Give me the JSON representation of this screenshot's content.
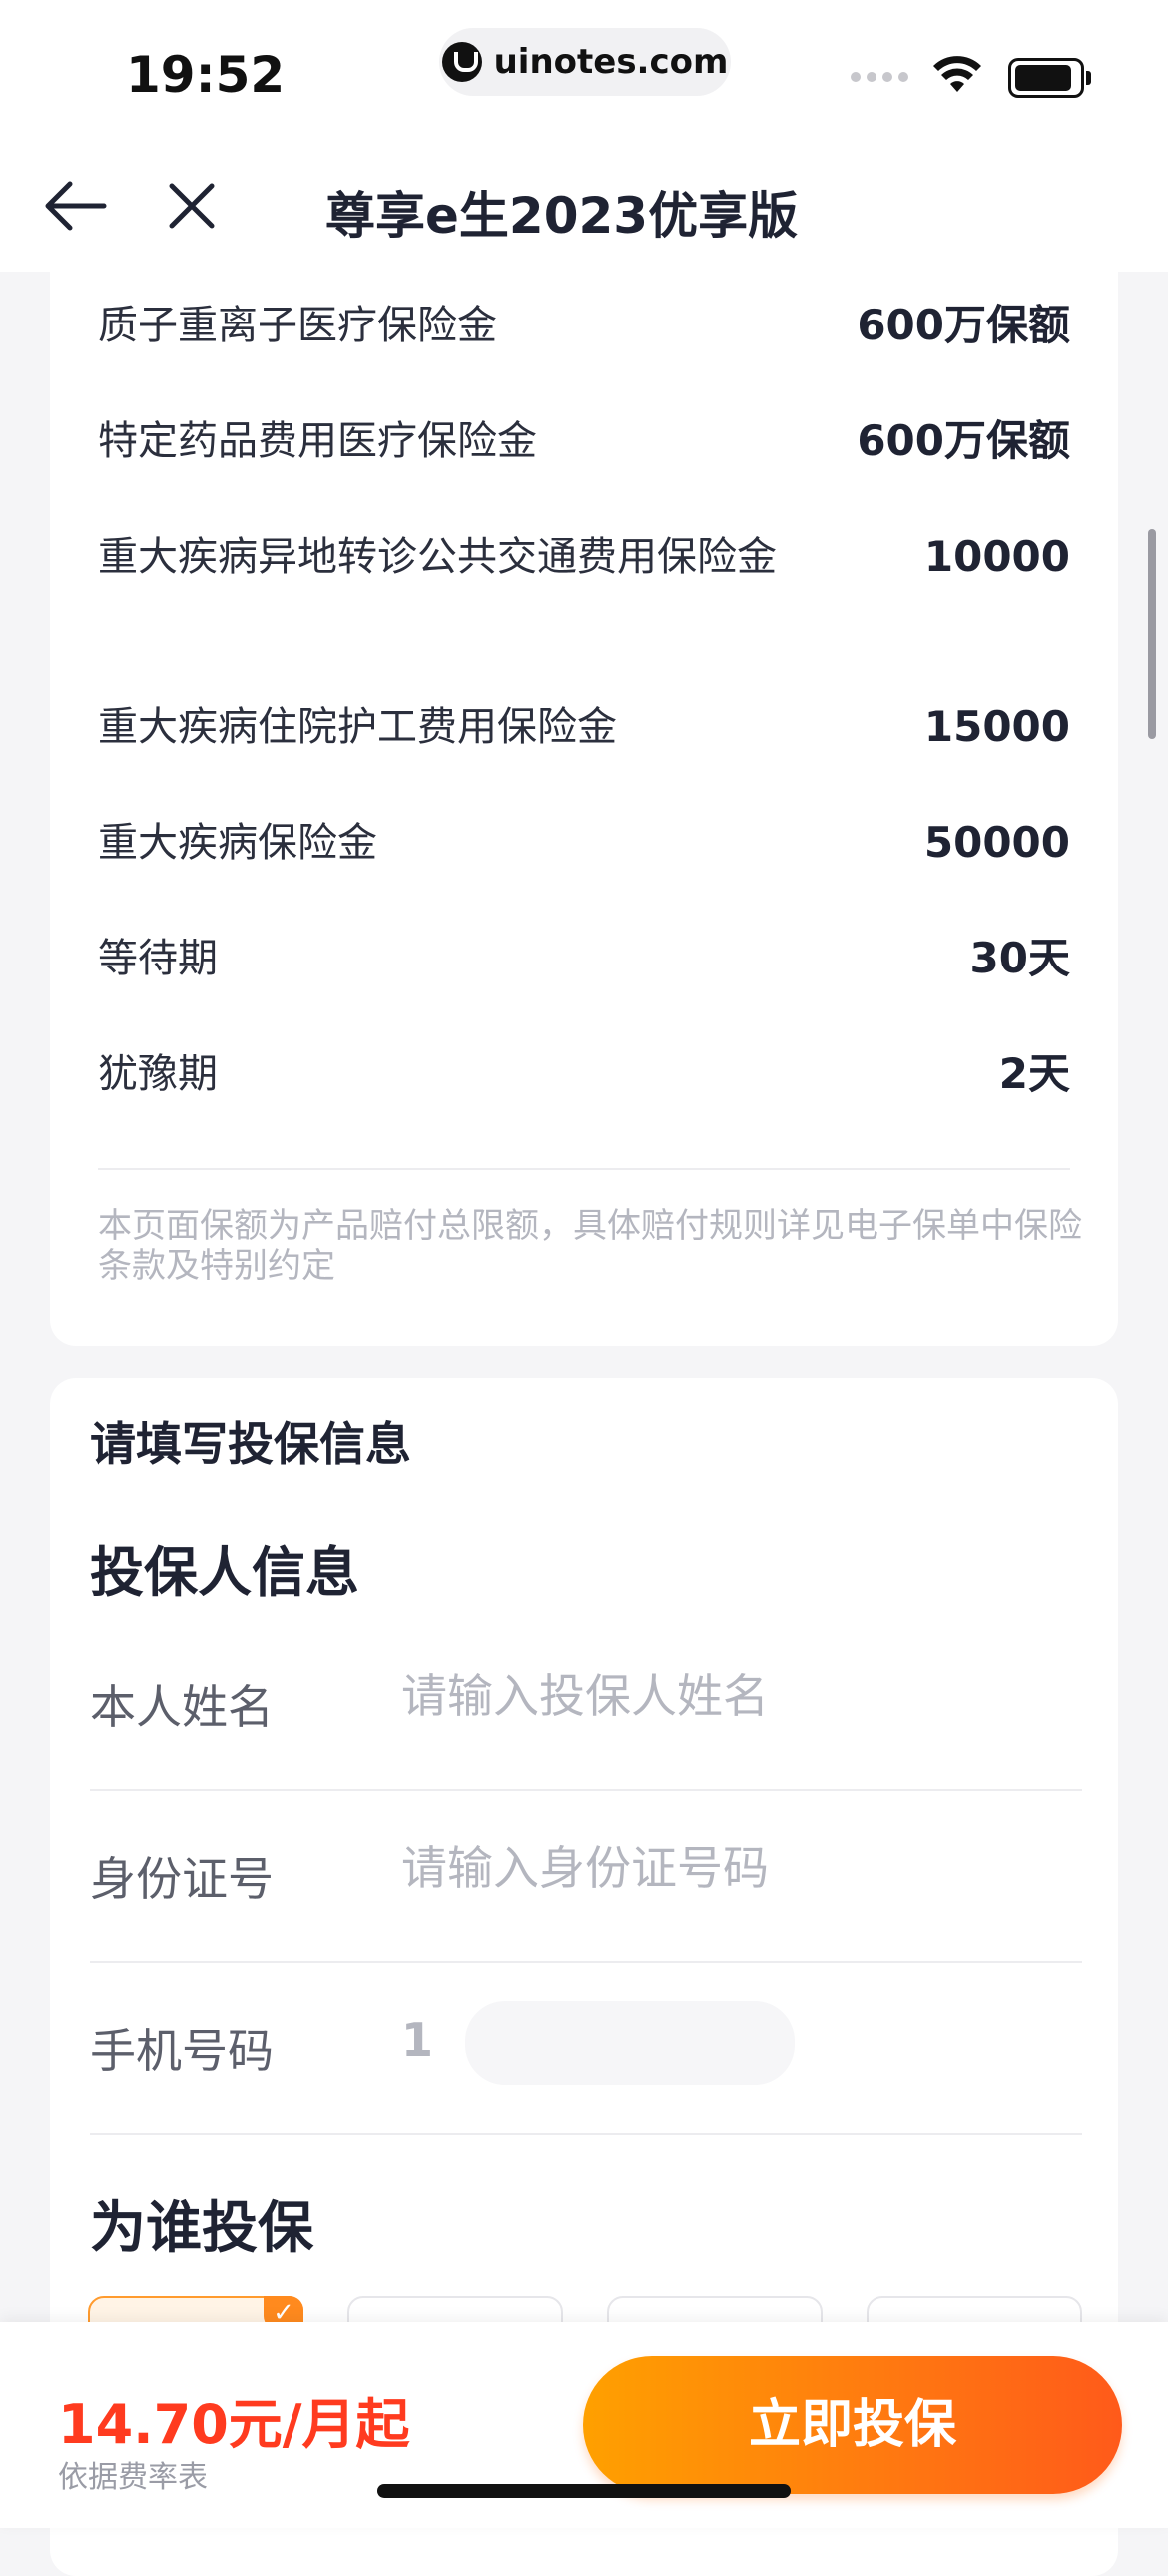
{
  "status_bar": {
    "time": "19:52",
    "url": "uinotes.com"
  },
  "nav": {
    "title": "尊享e生2023优享版",
    "back_icon": "arrow-left-icon",
    "close_icon": "close-icon"
  },
  "coverage": {
    "rows": [
      {
        "label": "质子重离子医疗保险金",
        "value": "600万保额"
      },
      {
        "label": "特定药品费用医疗保险金",
        "value": "600万保额"
      },
      {
        "label": "重大疾病异地转诊公共交通费用保险金",
        "value": "10000"
      },
      {
        "label": "重大疾病住院护工费用保险金",
        "value": "15000"
      },
      {
        "label": "重大疾病保险金",
        "value": "50000"
      },
      {
        "label": "等待期",
        "value": "30天"
      },
      {
        "label": "犹豫期",
        "value": "2天"
      }
    ],
    "note": "本页面保额为产品赔付总限额，具体赔付规则详见电子保单中保险条款及特别约定"
  },
  "form": {
    "title": "请填写投保信息",
    "section_title": "投保人信息",
    "name_label": "本人姓名",
    "name_placeholder": "请输入投保人姓名",
    "id_label": "身份证号",
    "id_placeholder": "请输入身份证号码",
    "phone_label": "手机号码",
    "phone_value": "1",
    "who_title": "为谁投保"
  },
  "bottom_bar": {
    "price": "14.70元/月起",
    "price_note": "依据费率表",
    "cta_label": "立即投保"
  },
  "colors": {
    "accent": "#ff7a10",
    "price": "#ff3b1f",
    "text": "#1f2333"
  }
}
